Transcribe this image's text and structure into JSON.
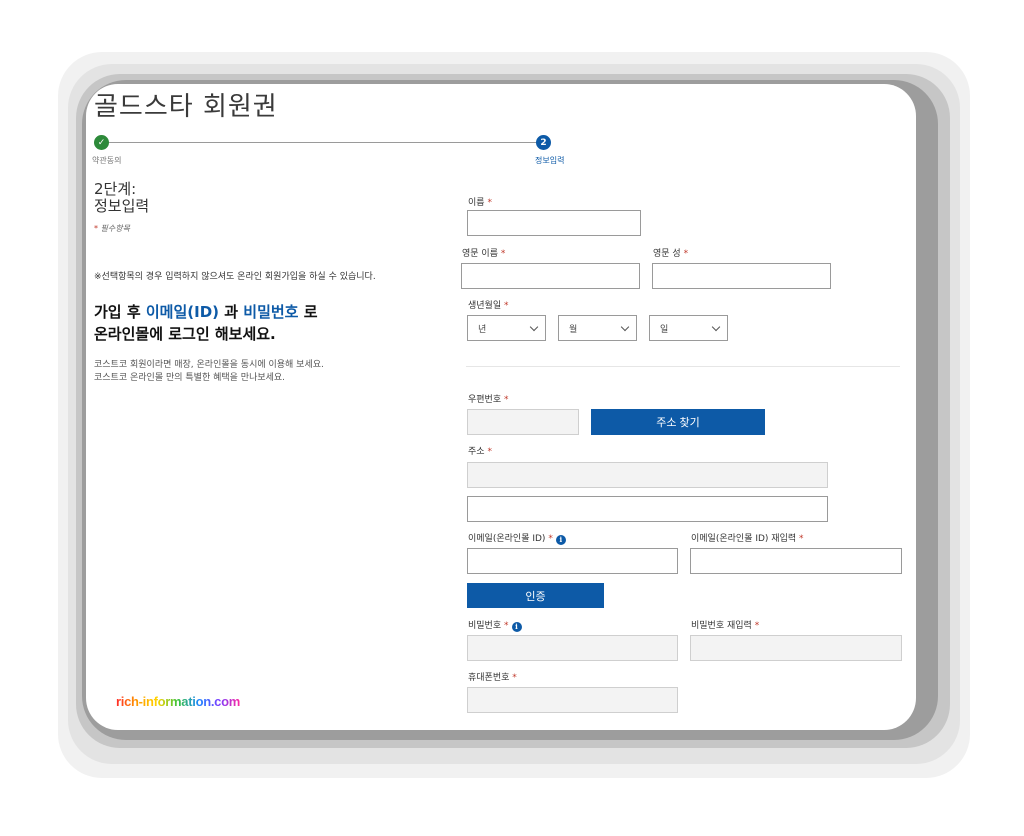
{
  "page": {
    "title": "골드스타 회원권"
  },
  "steps": [
    {
      "label": "약관동의",
      "marker": "✓",
      "state": "done"
    },
    {
      "label": "정보입력",
      "marker": "2",
      "state": "active"
    }
  ],
  "stage": {
    "line1": "2단계:",
    "line2": "정보입력"
  },
  "required_note": {
    "star": "*",
    "text": "필수항목"
  },
  "optional_note": "※선택항목의 경우 입력하지 않으셔도 온라인 회원가입을 하실 수 있습니다.",
  "promo": {
    "part1": "가입 후 ",
    "email": "이메일(ID)",
    "part2": " 과 ",
    "password": "비밀번호",
    "part3": " 로",
    "line2": "온라인몰에 로그인 해보세요."
  },
  "member_note": {
    "line1": "코스트코 회원이라면 매장, 온라인몰을 동시에 이용해 보세요.",
    "line2": "코스트코 온라인몰 만의 특별한 혜택을 만나보세요."
  },
  "form": {
    "required_star": "*",
    "name": {
      "label": "이름",
      "value": ""
    },
    "first_name_en": {
      "label": "영문 이름",
      "value": ""
    },
    "last_name_en": {
      "label": "영문 성",
      "value": ""
    },
    "birth": {
      "label": "생년월일",
      "year": "년",
      "month": "월",
      "day": "일"
    },
    "zip": {
      "label": "우편번호",
      "value": ""
    },
    "find_address_button": "주소 찾기",
    "address": {
      "label": "주소",
      "value": "",
      "detail": ""
    },
    "email": {
      "label": "이메일(온라인몰 ID)",
      "value": ""
    },
    "email_confirm": {
      "label": "이메일(온라인몰 ID) 재입력",
      "value": ""
    },
    "verify_button": "인증",
    "password": {
      "label": "비밀번호",
      "value": ""
    },
    "password_confirm": {
      "label": "비밀번호 재입력",
      "value": ""
    },
    "phone": {
      "label": "휴대폰번호",
      "value": ""
    }
  },
  "watermark": "rich-information.com",
  "colors": {
    "accent": "#0d5aa7",
    "success": "#2d8a3a",
    "required": "#c0392b"
  }
}
